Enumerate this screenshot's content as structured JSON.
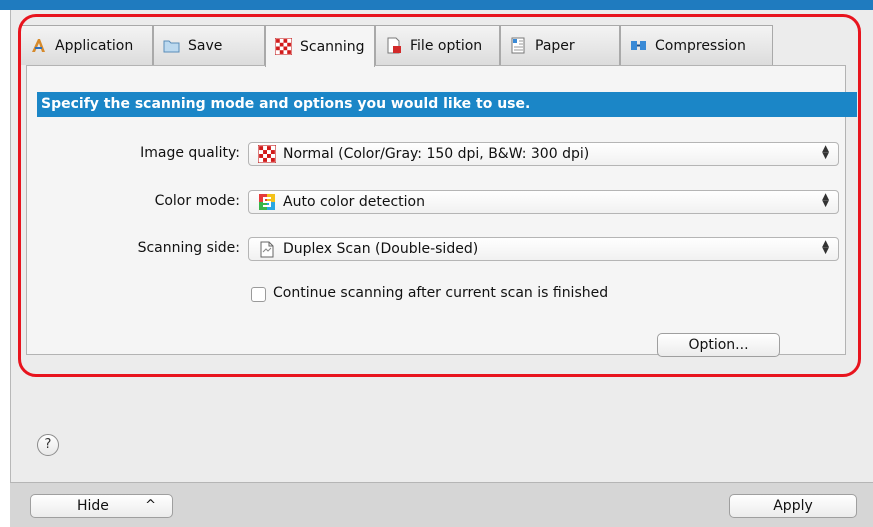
{
  "tabs": [
    {
      "label": "Application",
      "icon": "application-icon"
    },
    {
      "label": "Save",
      "icon": "folder-icon"
    },
    {
      "label": "Scanning",
      "icon": "scanning-checker-icon",
      "active": true
    },
    {
      "label": "File option",
      "icon": "file-option-icon"
    },
    {
      "label": "Paper",
      "icon": "paper-icon"
    },
    {
      "label": "Compression",
      "icon": "compression-icon"
    }
  ],
  "banner": "Specify the scanning mode and options you would like to use.",
  "settings": {
    "image_quality": {
      "label": "Image quality:",
      "value": "Normal (Color/Gray: 150 dpi, B&W: 300 dpi)",
      "icon": "checker-quality-icon"
    },
    "color_mode": {
      "label": "Color mode:",
      "value": "Auto color detection",
      "icon": "color-detect-icon"
    },
    "scanning_side": {
      "label": "Scanning side:",
      "value": "Duplex Scan (Double-sided)",
      "icon": "duplex-page-icon"
    }
  },
  "continue_scanning": {
    "label": "Continue scanning after current scan is finished",
    "checked": false
  },
  "option_button": "Option...",
  "help_button": "?",
  "footer": {
    "hide_label": "Hide",
    "hide_arrow": "^",
    "apply_label": "Apply"
  },
  "colors": {
    "accent_blue": "#1b86c7",
    "highlight_red": "#e8141e"
  }
}
